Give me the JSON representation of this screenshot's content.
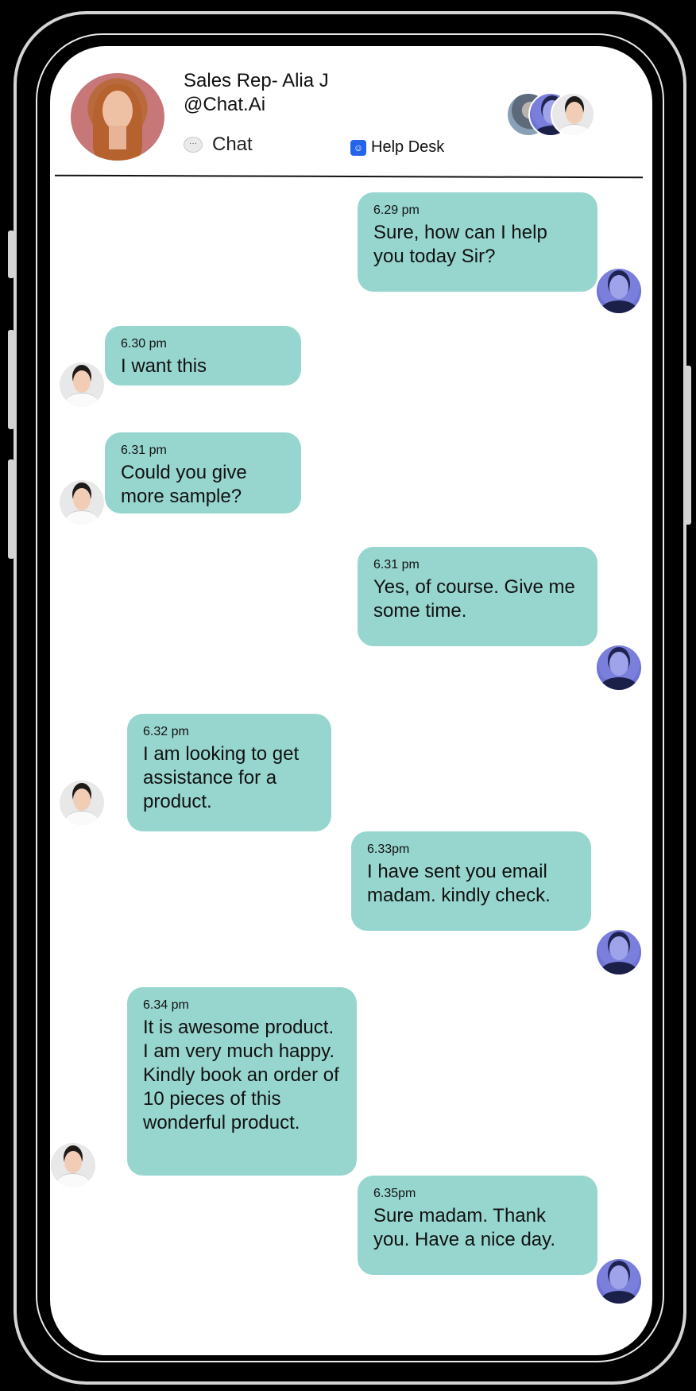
{
  "header": {
    "name": "Sales Rep- Alia J",
    "handle": "@Chat.Ai",
    "tabs": [
      {
        "label": "Chat",
        "icon": "speech-bubble-icon"
      },
      {
        "label": "Help Desk",
        "icon": "help-desk-icon"
      }
    ]
  },
  "colors": {
    "bubble": "#97d6cf",
    "screen": "#ffffff",
    "frame": "#000000"
  },
  "messages": [
    {
      "from": "agent",
      "time": "6.29 pm",
      "text": "Sure, how can I help you today Sir?"
    },
    {
      "from": "customer",
      "time": "6.30 pm",
      "text": "I want this"
    },
    {
      "from": "customer",
      "time": "6.31 pm",
      "text": "Could you give more sample?"
    },
    {
      "from": "agent",
      "time": "6.31 pm",
      "text": "Yes, of course. Give me some time."
    },
    {
      "from": "customer",
      "time": "6.32 pm",
      "text": "I am looking to get assistance for a product."
    },
    {
      "from": "agent",
      "time": "6.33pm",
      "text": "I have sent you email madam. kindly check."
    },
    {
      "from": "customer",
      "time": "6.34 pm",
      "text": "It is awesome product. I am very much happy. Kindly book an order of 10 pieces of this wonderful product."
    },
    {
      "from": "agent",
      "time": "6.35pm",
      "text": "Sure madam. Thank you. Have a nice day."
    }
  ]
}
